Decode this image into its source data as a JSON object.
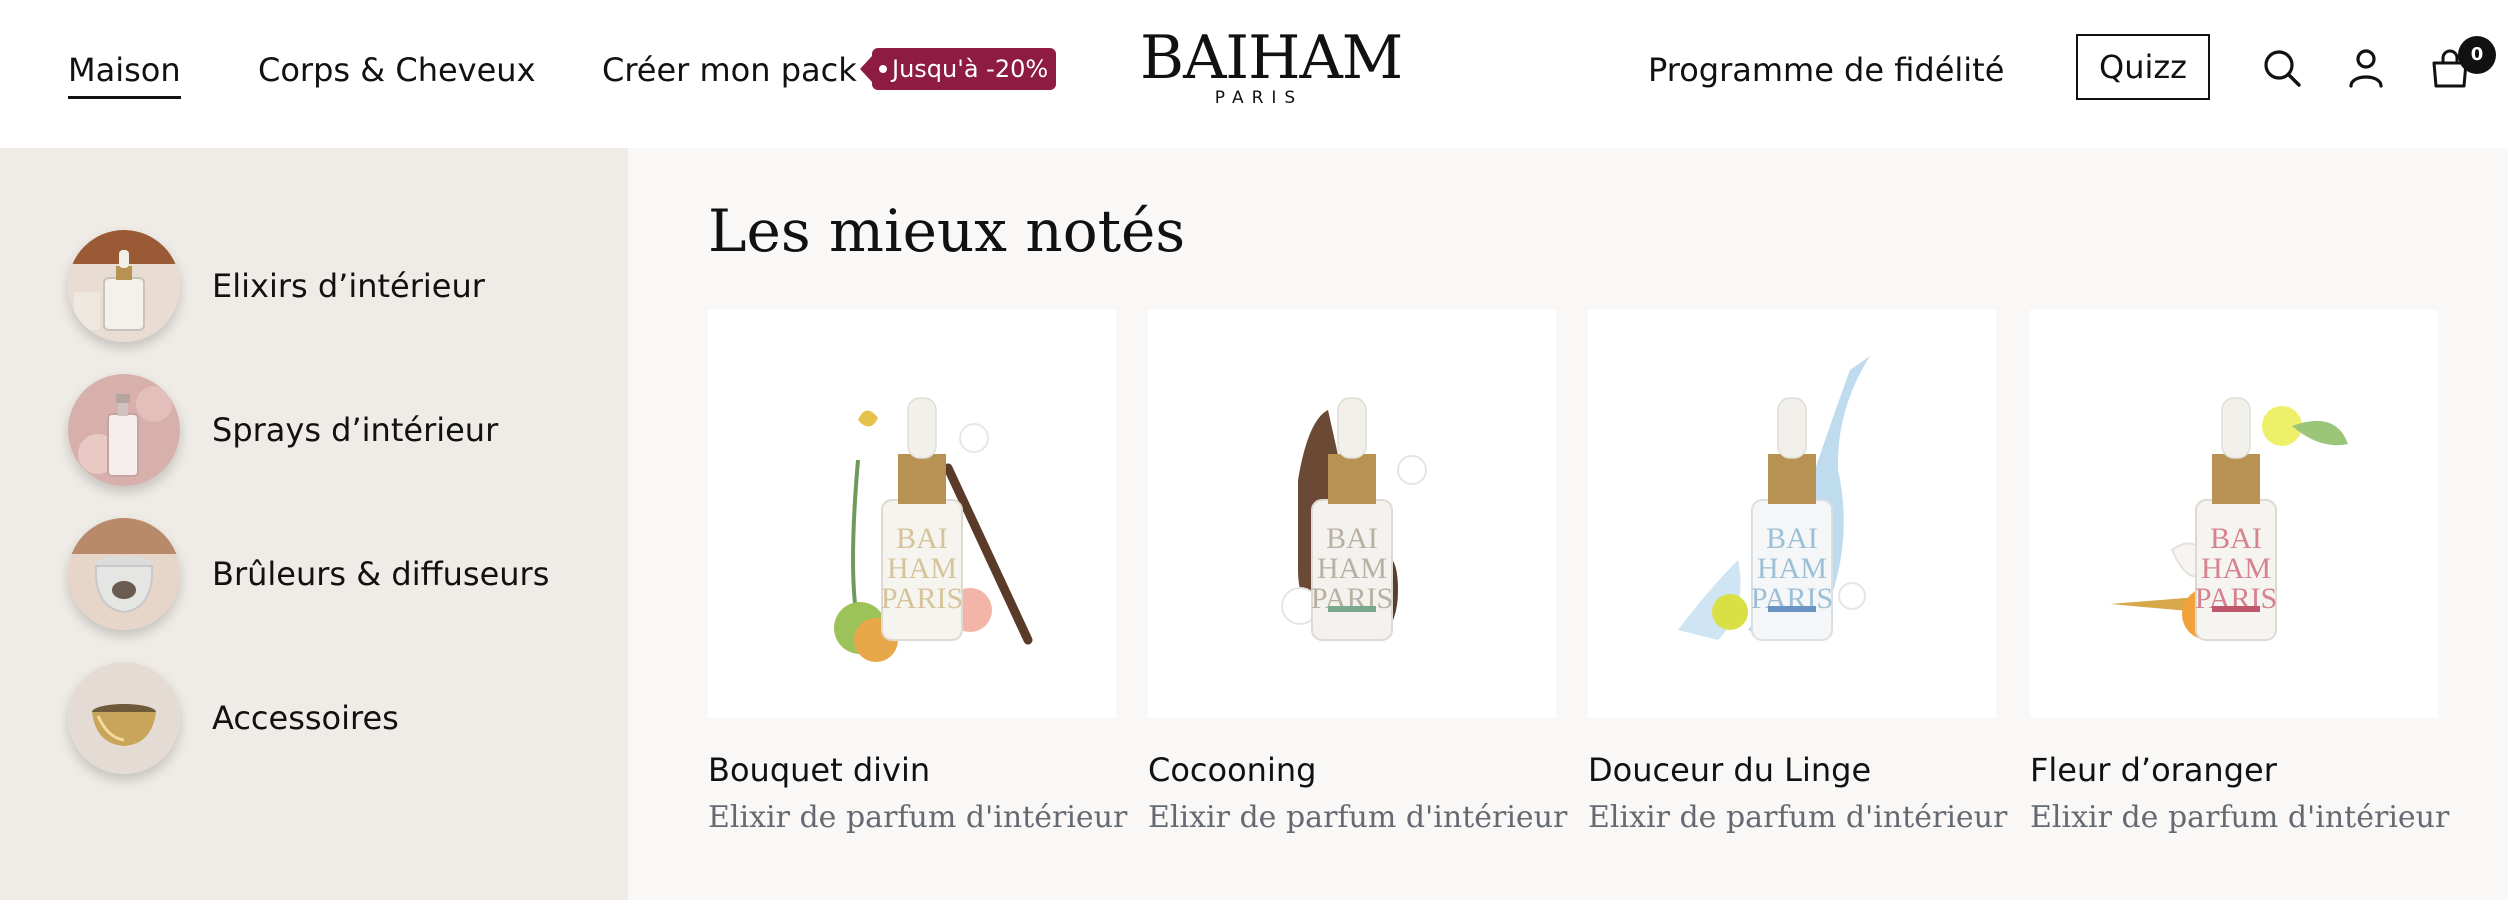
{
  "header": {
    "nav": [
      {
        "label": "Maison",
        "active": true
      },
      {
        "label": "Corps & Cheveux",
        "active": false
      },
      {
        "label": "Créer mon pack",
        "active": false
      }
    ],
    "promo_badge": "Jusqu'à -20%",
    "logo": {
      "main": "BAIHAM",
      "sub": "PARIS"
    },
    "loyalty_label": "Programme de fidélité",
    "quiz_label": "Quizz",
    "icons": [
      "search-icon",
      "account-icon",
      "cart-icon"
    ],
    "cart_count": "0"
  },
  "menu": {
    "categories": [
      {
        "label": "Elixirs d’intérieur",
        "icon": "elixir-thumbnail"
      },
      {
        "label": "Sprays d’intérieur",
        "icon": "spray-thumbnail"
      },
      {
        "label": "Brûleurs & diffuseurs",
        "icon": "burner-thumbnail"
      },
      {
        "label": "Accessoires",
        "icon": "bowl-thumbnail"
      }
    ]
  },
  "top_rated": {
    "title": "Les mieux notés",
    "products": [
      {
        "name": "Bouquet divin",
        "subtitle": "Elixir de parfum d'intérieur",
        "accent": "#c4a882"
      },
      {
        "name": "Cocooning",
        "subtitle": "Elixir de parfum d'intérieur",
        "accent": "#6b4a35"
      },
      {
        "name": "Douceur du Linge",
        "subtitle": "Elixir de parfum d'intérieur",
        "accent": "#9cc4e0"
      },
      {
        "name": "Fleur d’oranger",
        "subtitle": "Elixir de parfum d'intérieur",
        "accent": "#c0566a"
      }
    ]
  },
  "colors": {
    "brand_accent": "#8e1c42",
    "menu_background": "#efebe6",
    "content_background": "#f9f8f6"
  }
}
